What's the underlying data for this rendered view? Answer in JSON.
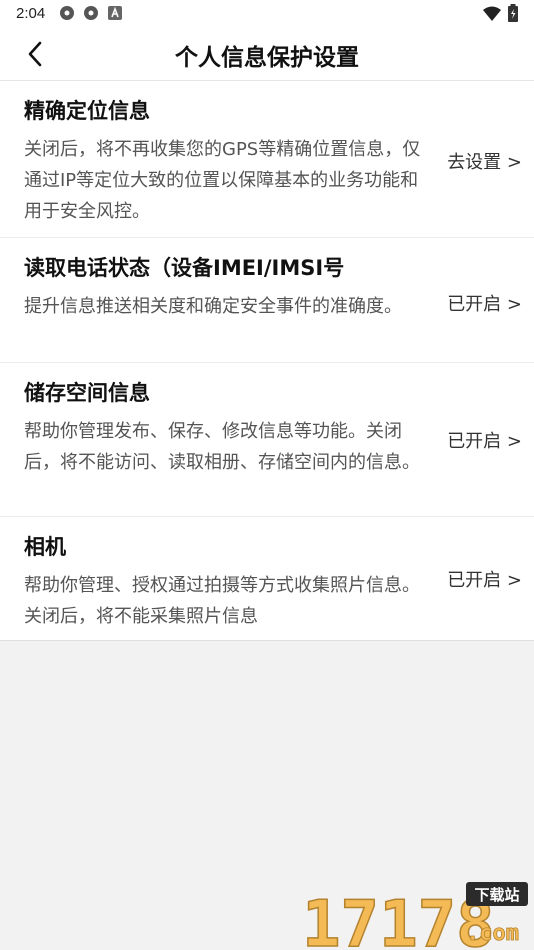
{
  "status_bar": {
    "time": "2:04"
  },
  "header": {
    "title": "个人信息保护设置"
  },
  "items": [
    {
      "title": "精确定位信息",
      "desc": "关闭后，将不再收集您的GPS等精确位置信息，仅通过IP等定位大致的位置以保障基本的业务功能和用于安全风控。",
      "action": "去设置 >"
    },
    {
      "title": "读取电话状态（设备IMEI/IMSI号",
      "desc": "提升信息推送相关度和确定安全事件的准确度。",
      "action": "已开启 >"
    },
    {
      "title": "储存空间信息",
      "desc": "帮助你管理发布、保存、修改信息等功能。关闭后，将不能访问、读取相册、存储空间内的信息。",
      "action": "已开启 >"
    },
    {
      "title": "相机",
      "desc": "帮助你管理、授权通过拍摄等方式收集照片信息。关闭后，将不能采集照片信息",
      "action": "已开启 >"
    }
  ],
  "watermark": {
    "brand": "17178",
    "tag": "下载站",
    "suffix": ".com"
  }
}
